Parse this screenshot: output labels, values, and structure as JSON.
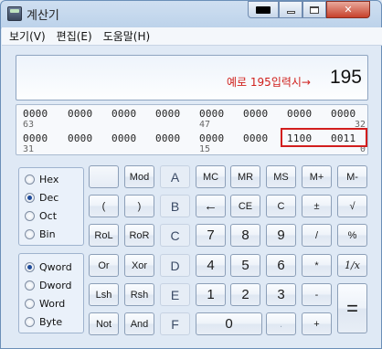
{
  "window": {
    "title": "계산기"
  },
  "menu": [
    "보기(V)",
    "편집(E)",
    "도움말(H)"
  ],
  "display": {
    "value": "195",
    "note": "예로 195입력시→"
  },
  "bits": {
    "row1": [
      "0000",
      "0000",
      "0000",
      "0000",
      "0000",
      "0000",
      "0000",
      "0000"
    ],
    "row1_idx": [
      "63",
      "47",
      "32"
    ],
    "row2": [
      "0000",
      "0000",
      "0000",
      "0000",
      "0000",
      "0000",
      "1100",
      "0011"
    ],
    "row2_idx": [
      "31",
      "15",
      "0"
    ]
  },
  "base": {
    "options": [
      "Hex",
      "Dec",
      "Oct",
      "Bin"
    ],
    "selected": "Dec"
  },
  "word": {
    "options": [
      "Qword",
      "Dword",
      "Word",
      "Byte"
    ],
    "selected": "Qword"
  },
  "keys": {
    "r1": [
      "",
      "Mod",
      "A",
      "MC",
      "MR",
      "MS",
      "M+",
      "M-"
    ],
    "r2": [
      "(",
      ")",
      "B",
      "←",
      "CE",
      "C",
      "±",
      "√"
    ],
    "r3": [
      "RoL",
      "RoR",
      "C",
      "7",
      "8",
      "9",
      "/",
      "%"
    ],
    "r4": [
      "Or",
      "Xor",
      "D",
      "4",
      "5",
      "6",
      "*",
      "1/x"
    ],
    "r5": [
      "Lsh",
      "Rsh",
      "E",
      "1",
      "2",
      "3",
      "-",
      "="
    ],
    "r6": [
      "Not",
      "And",
      "F",
      "0",
      ".",
      "+"
    ]
  }
}
